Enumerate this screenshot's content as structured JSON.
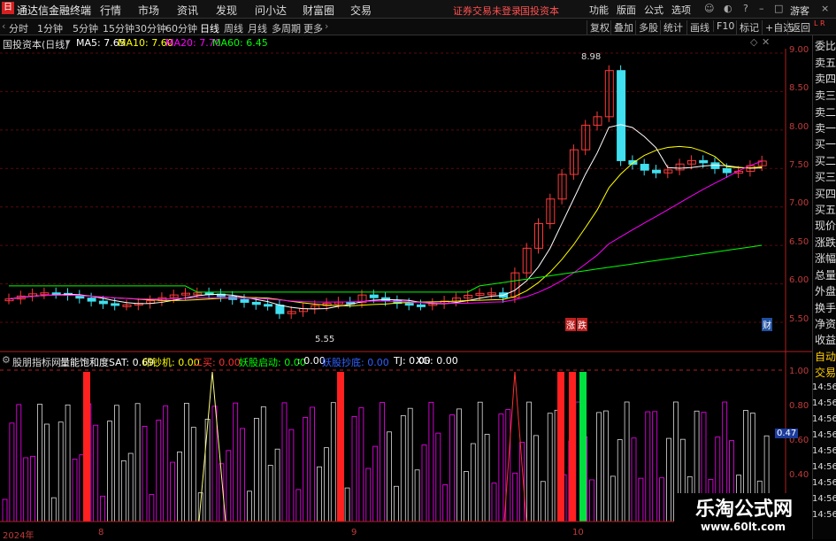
{
  "app": {
    "title": "通达信金融终端",
    "logo": "日"
  },
  "menu": [
    "行情",
    "市场",
    "资讯",
    "发现",
    "问小达",
    "财富圈",
    "交易"
  ],
  "notice": "证券交易未登录",
  "notice2": "国投资本",
  "top_right": [
    "功能",
    "版面",
    "公式",
    "选项"
  ],
  "guest": "游客",
  "periods": [
    "分时",
    "1分钟",
    "5分钟",
    "15分钟",
    "30分钟",
    "60分钟",
    "日线",
    "周线",
    "月线",
    "多周期",
    "更多"
  ],
  "active_period": "日线",
  "right_tools": [
    "复权",
    "叠加",
    "多股",
    "统计",
    "画线",
    "F10",
    "标记",
    "+自选",
    "返回"
  ],
  "info": {
    "name": "国投资本(日线)",
    "ma5": "MA5: 7.65",
    "ma10": "MA10: 7.60",
    "ma20": "MA20: 7.70",
    "ma60": "MA60: 6.45",
    "colors": {
      "ma5": "#ffffff",
      "ma10": "#ffff00",
      "ma20": "#ff00ff",
      "ma60": "#00ff00"
    }
  },
  "price_axis": [
    "9.00",
    "8.50",
    "8.00",
    "7.50",
    "7.00",
    "6.50",
    "6.00",
    "5.50"
  ],
  "high_label": "8.98",
  "low_label": "5.55",
  "tag_zhang": "涨",
  "tag_die": "跌",
  "tag_cai": "财",
  "indicator": {
    "name": "股朋指标网",
    "items": [
      {
        "text": "量能饱和度SAT: 0.69",
        "color": "#ffffff"
      },
      {
        "text": "印钞机: 0.00",
        "color": "#ffff00"
      },
      {
        "text": "二买: 0.00",
        "color": "#ff3030"
      },
      {
        "text": "妖股启动: 0.00",
        "color": "#00ff00"
      },
      {
        "text": ": 0.00",
        "color": "#ffffff"
      },
      {
        "text": "妖股抄底: 0.00",
        "color": "#3060ff"
      },
      {
        "text": "TJ: 0.00",
        "color": "#ffffff"
      },
      {
        "text": "XG: 0.00",
        "color": "#ffffff"
      }
    ]
  },
  "ind_axis": [
    "1.00",
    "0.80",
    "0.60",
    "0.40"
  ],
  "ind_current": "0.47",
  "date_axis": [
    "2024年",
    "8",
    "9",
    "10"
  ],
  "watermark_site": "乐淘公式网",
  "watermark_url": "www.60lt.com",
  "right_panel": [
    "委比",
    "卖五",
    "卖四",
    "卖三",
    "卖二",
    "卖一",
    "买一",
    "买二",
    "买三",
    "买四",
    "买五",
    "现价",
    "涨跌",
    "涨幅",
    "总量",
    "外盘",
    "换手",
    "净资",
    "收益",
    "自动",
    "交易"
  ],
  "time_list": [
    "14:56",
    "14:56",
    "14:56",
    "14:56",
    "14:56",
    "14:56",
    "14:56",
    "14:56",
    "14:56"
  ],
  "scale_mark": "L R"
}
